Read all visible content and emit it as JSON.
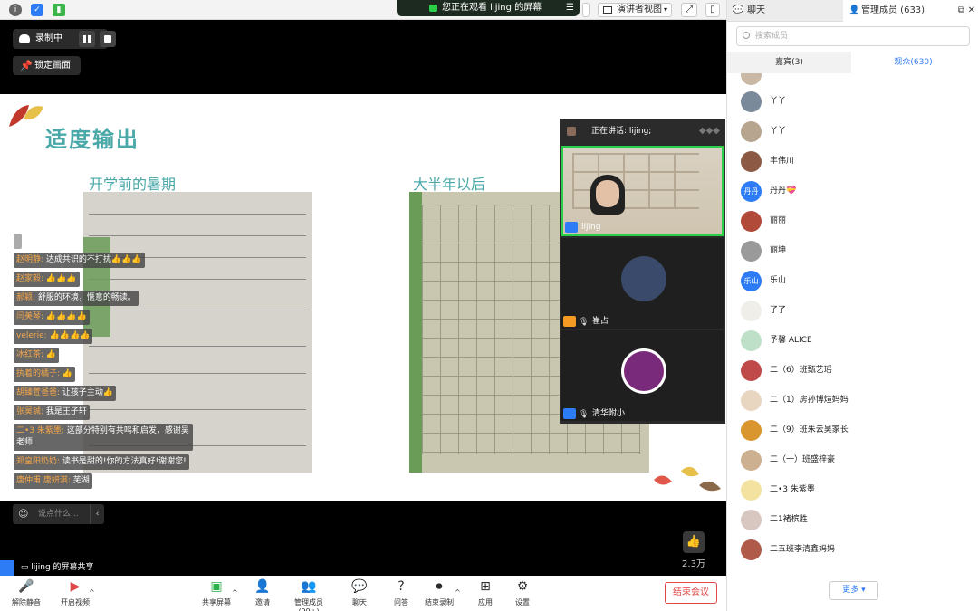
{
  "banner": {
    "text": "您正在观看 lijing 的屏幕"
  },
  "top_bar": {
    "presenter_view": "演讲者视图"
  },
  "recording": {
    "label": "录制中"
  },
  "lock_screen": {
    "label": "锁定画面"
  },
  "slide": {
    "title": "适度输出",
    "left_subtitle": "开学前的暑期",
    "right_subtitle": "大半年以后"
  },
  "chat": {
    "messages": [
      {
        "name": "赵明静:",
        "text": "达成共识的不打扰👍👍👍"
      },
      {
        "name": "赵家毅:",
        "text": "👍👍👍"
      },
      {
        "name": "郝颖:",
        "text": "舒服的环境，惬意的畅读。"
      },
      {
        "name": "闫美琴:",
        "text": "👍👍👍👍"
      },
      {
        "name": "velerie:",
        "text": "👍👍👍👍"
      },
      {
        "name": "冰红茶:",
        "text": "👍"
      },
      {
        "name": "执着的橘子:",
        "text": "👍"
      },
      {
        "name": "胡臻萱爸爸:",
        "text": "让孩子主动👍"
      },
      {
        "name": "张昊铖:",
        "text": "我是王子轩"
      },
      {
        "name": "二•3 朱紫墨:",
        "text": "这部分特别有共鸣和启发，感谢吴老师"
      },
      {
        "name": "郑皇阳奶奶:",
        "text": "读书是甜的!你的方法真好!谢谢您!"
      },
      {
        "name": "唐仲甫 唐妍淇:",
        "text": "芜湖"
      }
    ],
    "input_placeholder": "说点什么..."
  },
  "gallery": {
    "speaking": "正在讲话: lijing;",
    "tiles": [
      {
        "name": "lijing"
      },
      {
        "name": "崔占"
      },
      {
        "name": "清华附小"
      }
    ]
  },
  "reactions": {
    "count": "2.3万"
  },
  "share_label": "lijing 的屏幕共享",
  "toolbar": {
    "unmute": "解除静音",
    "start_video": "开启视频",
    "share_screen": "共享屏幕",
    "invite": "邀请",
    "manage_members": "管理成员(99+)",
    "chat": "聊天",
    "qa": "问答",
    "end_record": "结束录制",
    "apps": "应用",
    "settings": "设置",
    "end_meeting": "结束会议"
  },
  "panel": {
    "tab_chat": "聊天",
    "tab_members": "管理成员 (633)",
    "search_placeholder": "搜索成员",
    "guests_tab": "嘉宾(3)",
    "audience_tab": "观众(630)",
    "more": "更多",
    "members": [
      {
        "name": "丫丫",
        "color": "#7a8a9a",
        "initial": ""
      },
      {
        "name": "丫丫",
        "color": "#b7a58f",
        "initial": ""
      },
      {
        "name": "丰伟川",
        "color": "#8c5a44",
        "initial": ""
      },
      {
        "name": "丹丹💝",
        "color": "#2d7cf6",
        "initial": "丹丹"
      },
      {
        "name": "丽丽",
        "color": "#b24a3a",
        "initial": ""
      },
      {
        "name": "丽坤",
        "color": "#9a9a9a",
        "initial": ""
      },
      {
        "name": "乐山",
        "color": "#2d7cf6",
        "initial": "乐山"
      },
      {
        "name": "了了",
        "color": "#f0eee8",
        "initial": ""
      },
      {
        "name": "予馨 ALICE",
        "color": "#bfe0c8",
        "initial": ""
      },
      {
        "name": "二（6）班甄艺瑶",
        "color": "#c04a4a",
        "initial": ""
      },
      {
        "name": "二（1）房孙博煊妈妈",
        "color": "#e9d6c0",
        "initial": ""
      },
      {
        "name": "二（9）班朱云昊家长",
        "color": "#d9962e",
        "initial": ""
      },
      {
        "name": "二（一）班盛梓豪",
        "color": "#cdb08f",
        "initial": ""
      },
      {
        "name": "二•3 朱紫墨",
        "color": "#f4e2a0",
        "initial": ""
      },
      {
        "name": "二1褚槟胜",
        "color": "#d8c6c0",
        "initial": ""
      },
      {
        "name": "二五班李清鑫妈妈",
        "color": "#b05a4a",
        "initial": ""
      }
    ]
  }
}
